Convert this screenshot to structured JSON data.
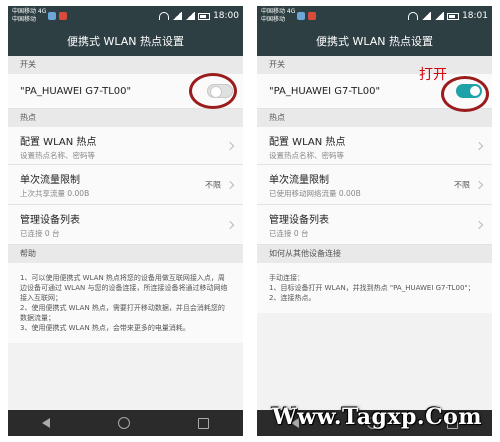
{
  "left": {
    "status": {
      "carrier_top": "中国移动 4G",
      "carrier_bottom": "中国移动",
      "time": "18:00"
    },
    "title": "便携式 WLAN 热点设置",
    "switch_header": "开关",
    "ssid": "\"PA_HUAWEI G7-TL00\"",
    "toggle_state": "off",
    "hotspot_header": "热点",
    "config": {
      "title": "配置 WLAN 热点",
      "sub": "设置热点名称、密码等"
    },
    "limit": {
      "title": "单次流量限制",
      "sub": "上次共享流量 0.00B",
      "value": "不限"
    },
    "devices": {
      "title": "管理设备列表",
      "sub": "已连接 0 台"
    },
    "help_header": "帮助",
    "help_lines": [
      "1、可以使用便携式 WLAN 热点将您的设备用做互联网接入点，周边设备可通过 WLAN 与您的设备连接，所连接设备将通过移动网络接入互联网；",
      "2、使用便携式 WLAN 热点，需要打开移动数据，并且会消耗您的数据流量；",
      "3、使用便携式 WLAN 热点，会带来更多的电量消耗。"
    ]
  },
  "right": {
    "status": {
      "carrier_top": "中国移动 4G",
      "carrier_bottom": "中国移动",
      "time": "18:01"
    },
    "title": "便携式 WLAN 热点设置",
    "switch_header": "开关",
    "ssid": "\"PA_HUAWEI G7-TL00\"",
    "toggle_state": "on",
    "hotspot_header": "热点",
    "config": {
      "title": "配置 WLAN 热点",
      "sub": "设置热点名称、密码等"
    },
    "limit": {
      "title": "单次流量限制",
      "sub": "已使用移动网络流量 0.00B",
      "value": "不限"
    },
    "devices": {
      "title": "管理设备列表",
      "sub": "已连接 0 台"
    },
    "help_header": "如何从其他设备连接",
    "help_lines": [
      "手动连接：",
      "1、目标设备打开 WLAN，并找到热点 \"PA_HUAWEI G7-TL00\"；",
      "2、连接热点。"
    ]
  },
  "annotation": "打开",
  "watermark": "Www.Tagxp.Com",
  "colors": {
    "titlebar": "#2e3f43",
    "toggle_on": "#1fa1a8",
    "ring": "#9b1c1c",
    "annotation": "#d4000e"
  }
}
